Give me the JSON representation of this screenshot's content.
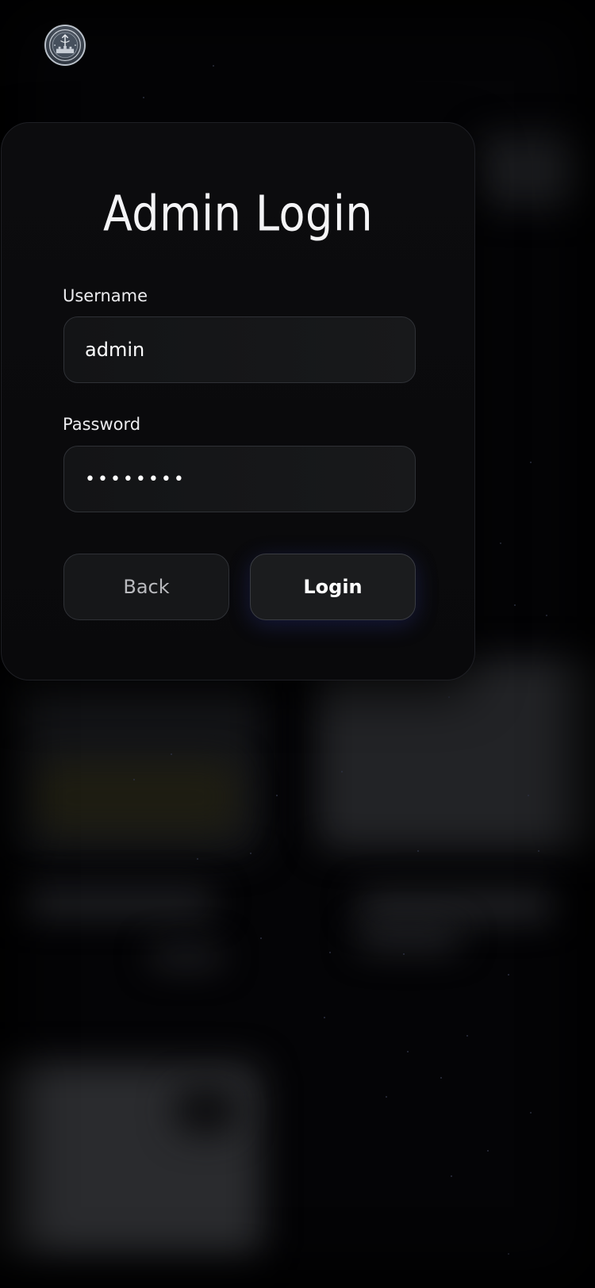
{
  "logo": {
    "icon": "emblem-logo-icon"
  },
  "login_card": {
    "title": "Admin Login",
    "username": {
      "label": "Username",
      "value": "admin"
    },
    "password": {
      "label": "Password",
      "value": "••••••••"
    },
    "buttons": {
      "back": "Back",
      "login": "Login"
    }
  },
  "colors": {
    "background": "#040406",
    "card": "#0c0c0e",
    "input_bg": "#16171a",
    "border": "#2f3136",
    "text": "#ffffff",
    "login_glow": "#3c46c8"
  }
}
